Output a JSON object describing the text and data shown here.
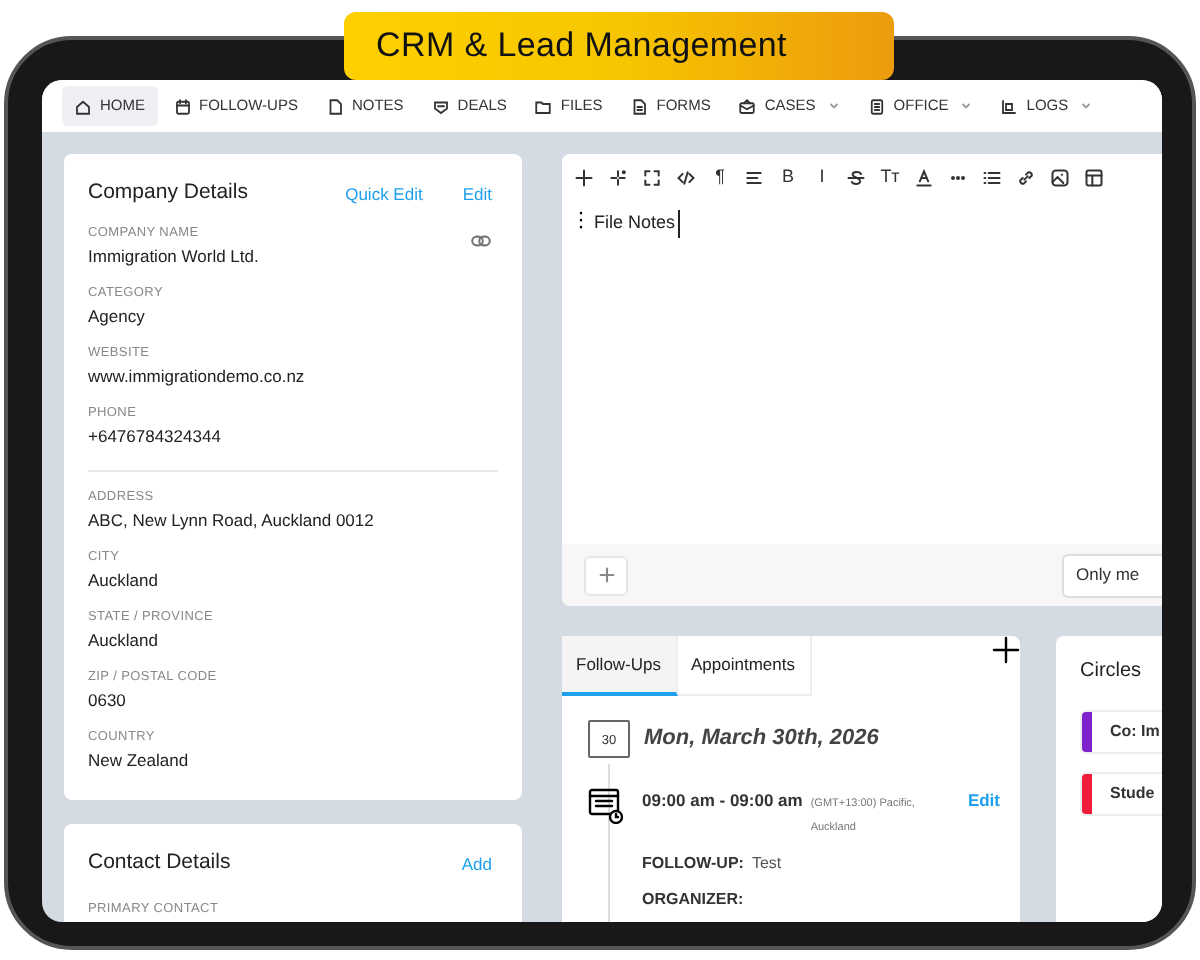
{
  "banner": {
    "title": "CRM & Lead Management"
  },
  "nav": [
    {
      "label": "HOME",
      "selected": true,
      "dropdown": false
    },
    {
      "label": "FOLLOW-UPS",
      "selected": false,
      "dropdown": false
    },
    {
      "label": "NOTES",
      "selected": false,
      "dropdown": false
    },
    {
      "label": "DEALS",
      "selected": false,
      "dropdown": false
    },
    {
      "label": "FILES",
      "selected": false,
      "dropdown": false
    },
    {
      "label": "FORMS",
      "selected": false,
      "dropdown": false
    },
    {
      "label": "CASES",
      "selected": false,
      "dropdown": true
    },
    {
      "label": "OFFICE",
      "selected": false,
      "dropdown": true
    },
    {
      "label": "LOGS",
      "selected": false,
      "dropdown": true
    }
  ],
  "company_details": {
    "title": "Company Details",
    "actions": [
      "Quick Edit",
      "Edit"
    ],
    "fields": [
      {
        "label": "COMPANY NAME",
        "value": "Immigration World Ltd."
      },
      {
        "label": "CATEGORY",
        "value": "Agency"
      },
      {
        "label": "WEBSITE",
        "value": "www.immigrationdemo.co.nz"
      },
      {
        "label": "PHONE",
        "value": "+6476784324344"
      },
      {
        "label": "ADDRESS",
        "value": "ABC, New Lynn Road, Auckland 0012"
      },
      {
        "label": "CITY",
        "value": "Auckland"
      },
      {
        "label": "STATE / PROVINCE",
        "value": "Auckland"
      },
      {
        "label": "ZIP / POSTAL CODE",
        "value": "0630"
      },
      {
        "label": "COUNTRY",
        "value": "New Zealand"
      }
    ]
  },
  "contact_details": {
    "title": "Contact Details",
    "action": "Add",
    "field_label": "PRIMARY CONTACT"
  },
  "editor": {
    "toolbar": [
      {
        "kind": "icon"
      },
      {
        "kind": "icon"
      },
      {
        "kind": "icon"
      },
      {
        "kind": "icon"
      },
      {
        "kind": "glyph",
        "text": "¶"
      },
      {
        "kind": "icon"
      },
      {
        "kind": "glyph",
        "text": "B"
      },
      {
        "kind": "glyph",
        "text": "I"
      },
      {
        "kind": "icon"
      },
      {
        "kind": "glyph",
        "text": "Tт"
      },
      {
        "kind": "icon"
      },
      {
        "kind": "icon"
      },
      {
        "kind": "icon"
      },
      {
        "kind": "icon"
      },
      {
        "kind": "icon"
      },
      {
        "kind": "icon"
      }
    ],
    "content": "File Notes",
    "visibility": "Only me"
  },
  "activity": {
    "tabs": [
      {
        "label": "Follow-Ups",
        "selected": true
      },
      {
        "label": "Appointments",
        "selected": false
      }
    ],
    "date": "Mon, March 30th, 2026",
    "calendar_day": "30",
    "time": "09:00 am - 09:00 am",
    "timezone": "(GMT+13:00) Pacific, Auckland",
    "edit": "Edit",
    "details": [
      {
        "label": "FOLLOW-UP:",
        "value": "Test"
      },
      {
        "label": "ORGANIZER:"
      }
    ]
  },
  "circles": {
    "title": "Circles",
    "items": [
      {
        "label": "Co: Im",
        "color": "#7e22ce"
      },
      {
        "label": "Stude",
        "color": "#ef1c3a"
      }
    ]
  }
}
